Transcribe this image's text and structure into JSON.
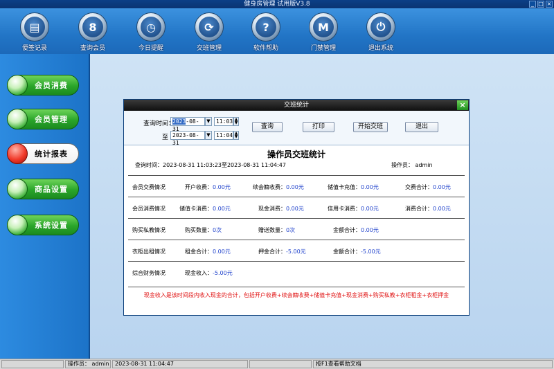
{
  "window": {
    "title": "健身房管理 试用版V3.8"
  },
  "toolbar": [
    {
      "label": "便签记录",
      "icon": "notepad-icon"
    },
    {
      "label": "查询会员",
      "icon": "member-search-icon"
    },
    {
      "label": "今日提醒",
      "icon": "clock-icon"
    },
    {
      "label": "交班管理",
      "icon": "refresh-icon"
    },
    {
      "label": "软件帮助",
      "icon": "help-icon"
    },
    {
      "label": "门禁管理",
      "icon": "m-icon"
    },
    {
      "label": "退出系统",
      "icon": "power-icon"
    }
  ],
  "nav": [
    {
      "label": "会员消费"
    },
    {
      "label": "会员管理"
    },
    {
      "label": "统计报表",
      "active": true
    },
    {
      "label": "商品设置"
    },
    {
      "label": "系统设置"
    }
  ],
  "dialog": {
    "title": "交班统计",
    "close": "×",
    "filter": {
      "query_time_label": "查询时间：",
      "to_label": "至",
      "from_year": "2023",
      "from_rest": "-08-31",
      "from_time": "11:03",
      "to_date": "2023-08-31",
      "to_time": "11:04",
      "query_btn": "查询",
      "print_btn": "打印",
      "start_btn": "开始交班",
      "exit_btn": "退出"
    },
    "report": {
      "title": "操作员交班统计",
      "period": "查询时间：2023-08-31 11:03:23至2023-08-31 11:04:47",
      "operator": "操作员： admin",
      "rows": [
        {
          "label": "会员交费情况",
          "items": [
            {
              "k": "开户收费：",
              "v": "0.00元"
            },
            {
              "k": "续会籍收费：",
              "v": "0.00元"
            },
            {
              "k": "储值卡充值：",
              "v": "0.00元"
            },
            {
              "k": "交费合计：",
              "v": "0.00元"
            }
          ]
        },
        {
          "label": "会员消费情况",
          "items": [
            {
              "k": "储值卡消费：",
              "v": "0.00元"
            },
            {
              "k": "现金消费：",
              "v": "0.00元"
            },
            {
              "k": "信用卡消费：",
              "v": "0.00元"
            },
            {
              "k": "消费合计：",
              "v": "0.00元"
            }
          ]
        },
        {
          "label": "购买私教情况",
          "items": [
            {
              "k": "购买数量：",
              "v": "0次"
            },
            {
              "k": "赠送数量：",
              "v": "0次"
            },
            {
              "k": "金额合计：",
              "v": "0.00元"
            }
          ]
        },
        {
          "label": "衣柜出租情况",
          "items": [
            {
              "k": "租金合计：",
              "v": "0.00元"
            },
            {
              "k": "押金合计：",
              "v": "-5.00元"
            },
            {
              "k": "金额合计：",
              "v": "-5.00元"
            }
          ]
        },
        {
          "label": "综合财务情况",
          "items": [
            {
              "k": "现金收入：",
              "v": "-5.00元"
            }
          ]
        }
      ],
      "note": "现金收入是该时间段内收入现金的合计，包括开户收费+续会籍收费+储值卡充值+现金消费+购买私教+衣柜租金+衣柜押金"
    }
  },
  "statusbar": {
    "operator": "操作员： admin",
    "datetime": "2023-08-31 11:04:47",
    "help": "按F1查看帮助文档"
  }
}
